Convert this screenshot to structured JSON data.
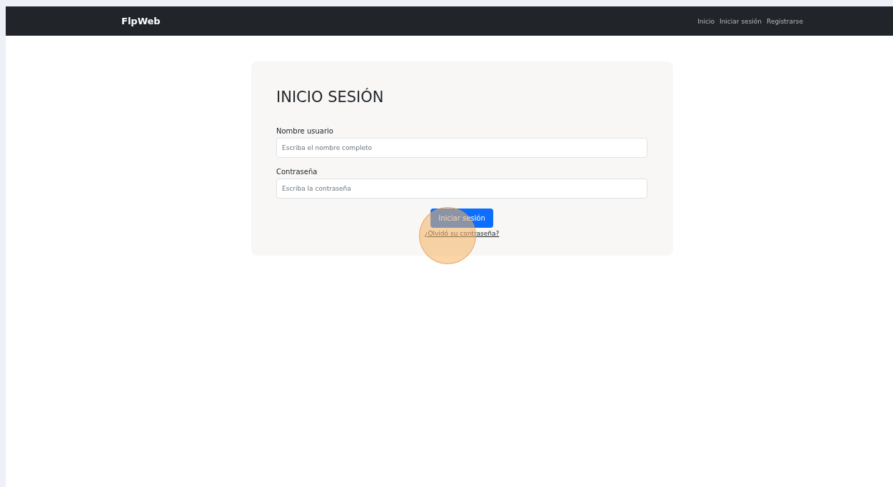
{
  "navbar": {
    "brand": "FlpWeb",
    "links": [
      "Inicio",
      "Iniciar sesión",
      "Registrarse"
    ]
  },
  "form": {
    "title": "INICIO SESIÓN",
    "fields": [
      {
        "label": "Nombre usuario",
        "placeholder": "Escriba el nombre completo"
      },
      {
        "label": "Contraseña",
        "placeholder": "Escriba la contraseña"
      }
    ],
    "submit": "Iniciar sesión",
    "forgot_link": "¿Olvidó su contraseña?"
  },
  "click_highlight": true
}
